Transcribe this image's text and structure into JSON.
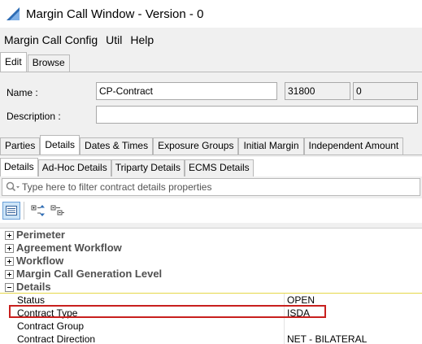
{
  "window": {
    "title": "Margin Call Window - Version - 0"
  },
  "menu": {
    "items": [
      "Margin Call Config",
      "Util",
      "Help"
    ]
  },
  "mode_tabs": {
    "items": [
      "Edit",
      "Browse"
    ],
    "active": "Edit"
  },
  "form": {
    "name_label": "Name :",
    "name_value": "CP-Contract",
    "id_value": "31800",
    "version_value": "0",
    "description_label": "Description :",
    "description_value": ""
  },
  "main_tabs": {
    "items": [
      "Parties",
      "Details",
      "Dates & Times",
      "Exposure Groups",
      "Initial Margin",
      "Independent Amount"
    ],
    "active": "Details"
  },
  "sub_tabs": {
    "items": [
      "Details",
      "Ad-Hoc Details",
      "Triparty Details",
      "ECMS Details"
    ],
    "active": "Details"
  },
  "filter": {
    "placeholder": "Type here to filter contract details properties"
  },
  "tree": {
    "collapsed_groups": [
      "Perimeter",
      "Agreement Workflow",
      "Workflow",
      "Margin Call Generation Level"
    ],
    "expanded_group": "Details",
    "properties": [
      {
        "name": "Status",
        "value": "OPEN"
      },
      {
        "name": "Contract Type",
        "value": "ISDA"
      },
      {
        "name": "Contract Group",
        "value": ""
      },
      {
        "name": "Contract Direction",
        "value": "NET - BILATERAL"
      }
    ]
  },
  "colors": {
    "highlight": "#c8201e",
    "selected_button": "#cce4f7",
    "group_underline": "#e6d84a"
  }
}
